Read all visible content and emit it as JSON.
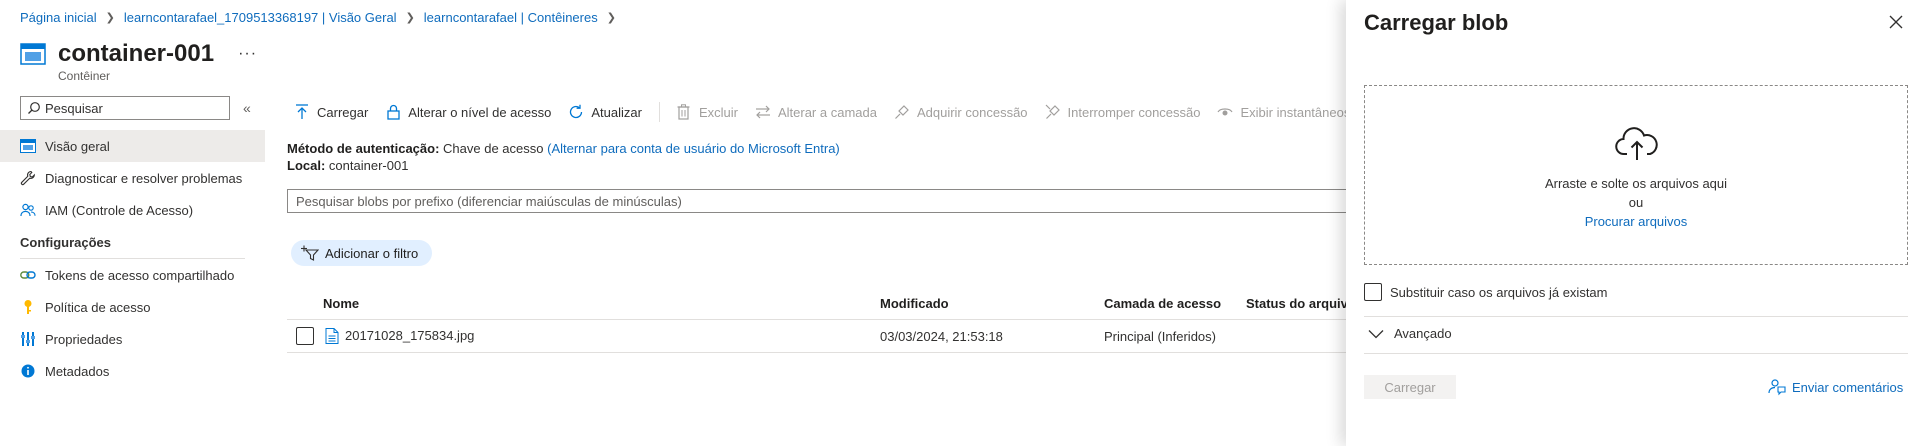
{
  "breadcrumb": {
    "items": [
      "Página inicial",
      "learncontarafael_1709513368197 | Visão Geral",
      "learncontarafael | Contêineres"
    ]
  },
  "page": {
    "title": "container-001",
    "subtitle": "Contêiner",
    "more": "···"
  },
  "sidebar": {
    "search_placeholder": "Pesquisar",
    "items": [
      {
        "label": "Visão geral",
        "icon": "overview-icon",
        "active": true
      },
      {
        "label": "Diagnosticar e resolver problemas",
        "icon": "wrench-icon"
      },
      {
        "label": "IAM (Controle de Acesso)",
        "icon": "people-icon"
      }
    ],
    "section_title": "Configurações",
    "settings_items": [
      {
        "label": "Tokens de acesso compartilhado",
        "icon": "link-icon"
      },
      {
        "label": "Política de acesso",
        "icon": "key-icon"
      },
      {
        "label": "Propriedades",
        "icon": "properties-icon"
      },
      {
        "label": "Metadados",
        "icon": "info-icon"
      }
    ]
  },
  "toolbar": {
    "upload": "Carregar",
    "change_access": "Alterar o nível de acesso",
    "refresh": "Atualizar",
    "delete": "Excluir",
    "change_tier": "Alterar a camada",
    "acquire_lease": "Adquirir concessão",
    "break_lease": "Interromper concessão",
    "snapshots": "Exibir instantâneos"
  },
  "auth": {
    "method_label": "Método de autenticação:",
    "method_value": "Chave de acesso",
    "switch_link": "(Alternar para conta de usuário do Microsoft Entra)",
    "location_label": "Local:",
    "location_value": "container-001"
  },
  "blob_search": {
    "placeholder": "Pesquisar blobs por prefixo (diferenciar maiúsculas de minúsculas)"
  },
  "filter": {
    "label": "Adicionar o filtro"
  },
  "table": {
    "headers": [
      "Nome",
      "Modificado",
      "Camada de acesso",
      "Status do arquivo"
    ],
    "rows": [
      {
        "name": "20171028_175834.jpg",
        "modified": "03/03/2024, 21:53:18",
        "tier": "Principal (Inferidos)",
        "status": ""
      }
    ]
  },
  "upload_panel": {
    "title": "Carregar blob",
    "drop_text": "Arraste e solte os arquivos aqui",
    "or": "ou",
    "browse": "Procurar arquivos",
    "overwrite_label": "Substituir caso os arquivos já existam",
    "advanced": "Avançado",
    "upload_button": "Carregar",
    "feedback": "Enviar comentários"
  },
  "colors": {
    "link": "#0f6cbd",
    "accent": "#0078d4",
    "disabled": "#a19f9d",
    "active_nav": "#edebe9",
    "filter_pill": "#e1efff"
  }
}
